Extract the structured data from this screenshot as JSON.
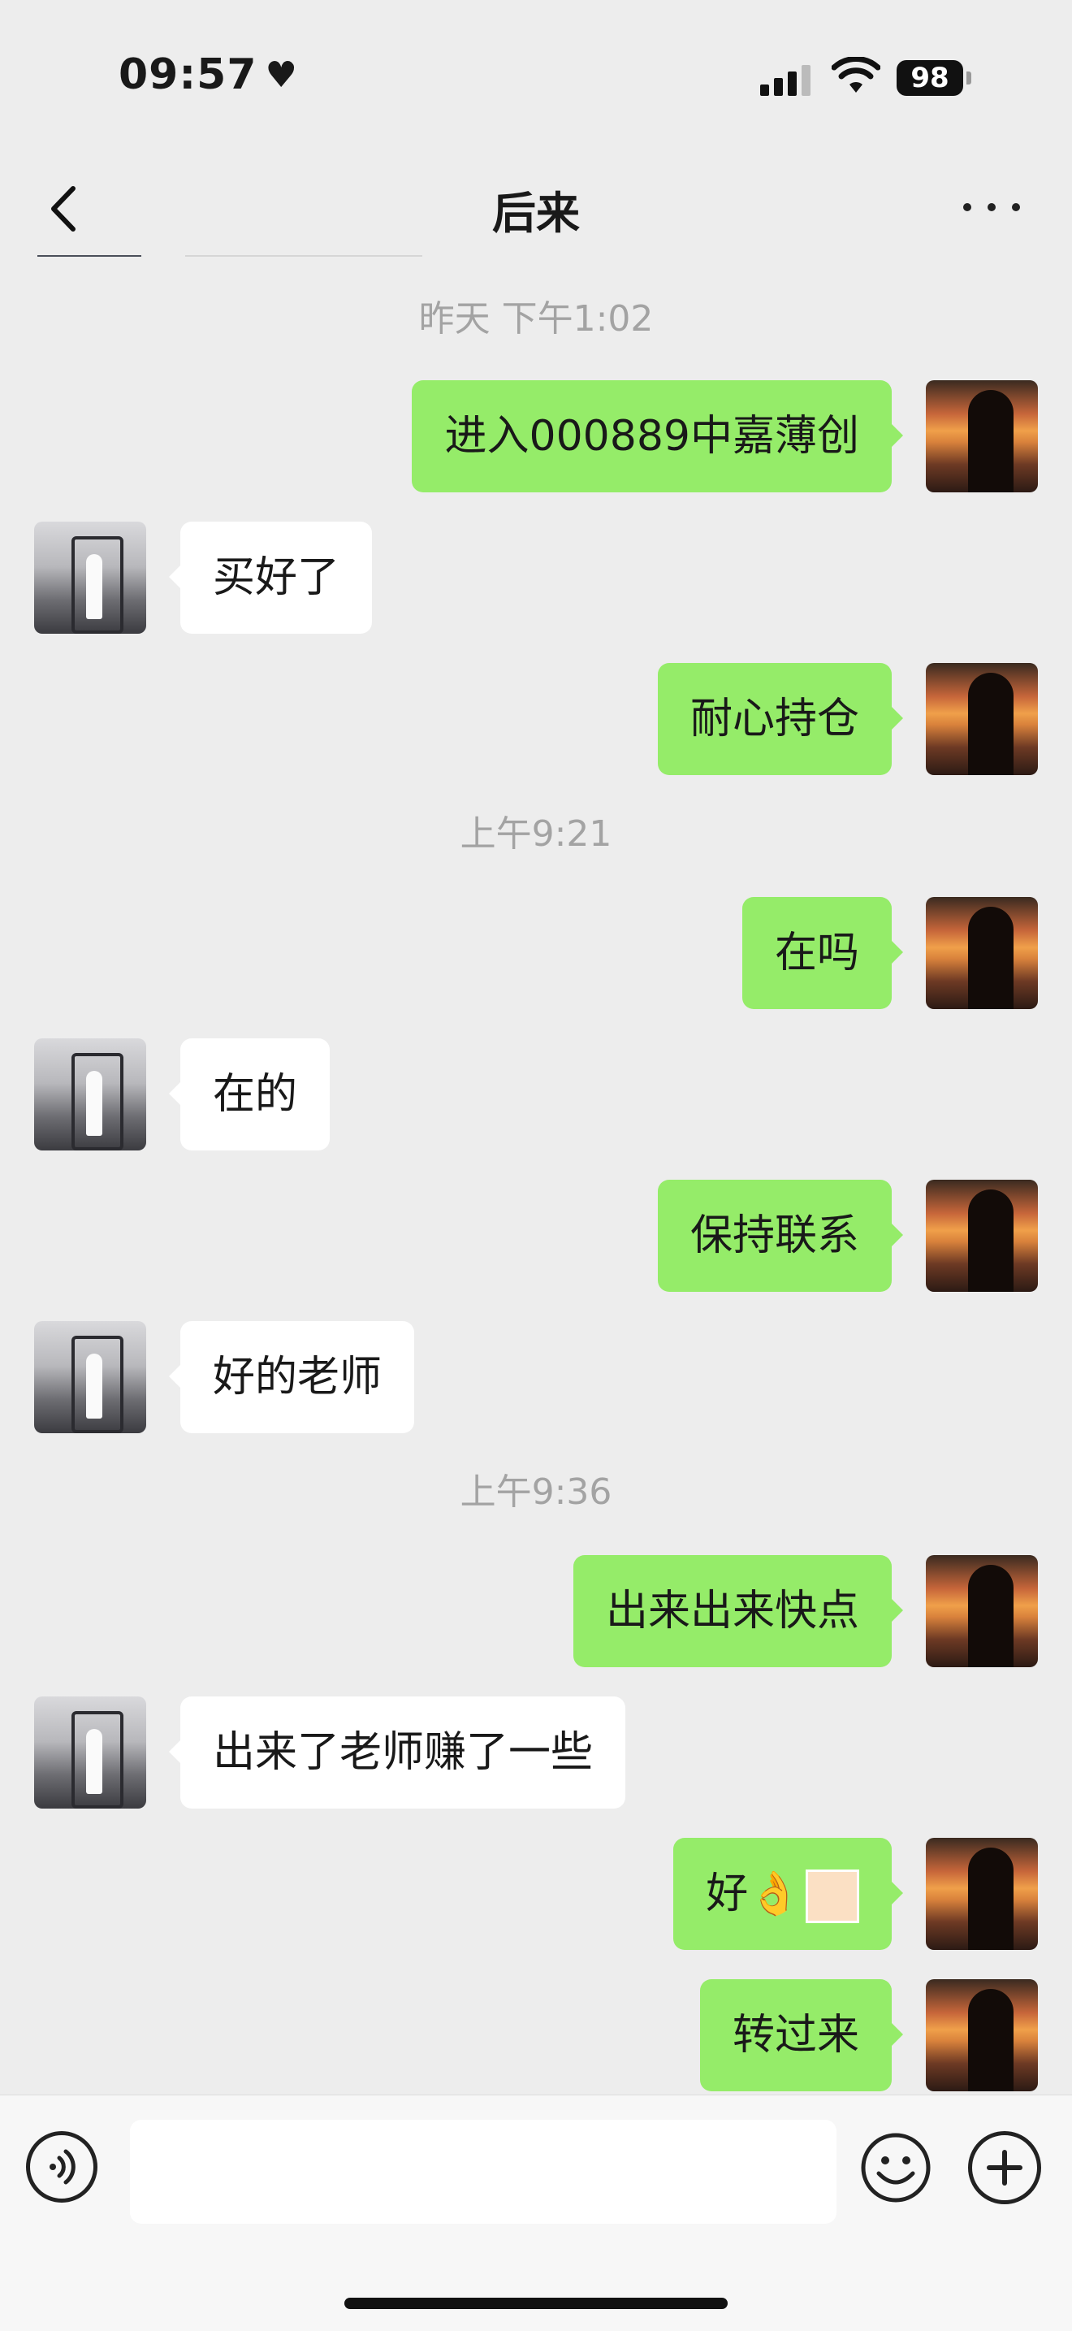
{
  "status_bar": {
    "time": "09:57",
    "battery": "98"
  },
  "header": {
    "title": "后来"
  },
  "messages": [
    {
      "type": "timestamp",
      "text": "昨天 下午1:02"
    },
    {
      "type": "sent",
      "text": "进入000889中嘉薄创"
    },
    {
      "type": "received",
      "text": "买好了"
    },
    {
      "type": "sent",
      "text": "耐心持仓"
    },
    {
      "type": "timestamp",
      "text": "上午9:21"
    },
    {
      "type": "sent",
      "text": "在吗"
    },
    {
      "type": "received",
      "text": "在的"
    },
    {
      "type": "sent",
      "text": "保持联系"
    },
    {
      "type": "received",
      "text": "好的老师"
    },
    {
      "type": "timestamp",
      "text": "上午9:36"
    },
    {
      "type": "sent",
      "text": "出来出来快点"
    },
    {
      "type": "received",
      "text": "出来了老师赚了一些"
    },
    {
      "type": "sent",
      "text": "好👌"
    },
    {
      "type": "sent",
      "text": "转过来"
    }
  ],
  "input": {
    "value": "",
    "placeholder": ""
  },
  "colors": {
    "sent_bubble": "#95ec69",
    "received_bubble": "#ffffff",
    "background": "#ededed"
  }
}
